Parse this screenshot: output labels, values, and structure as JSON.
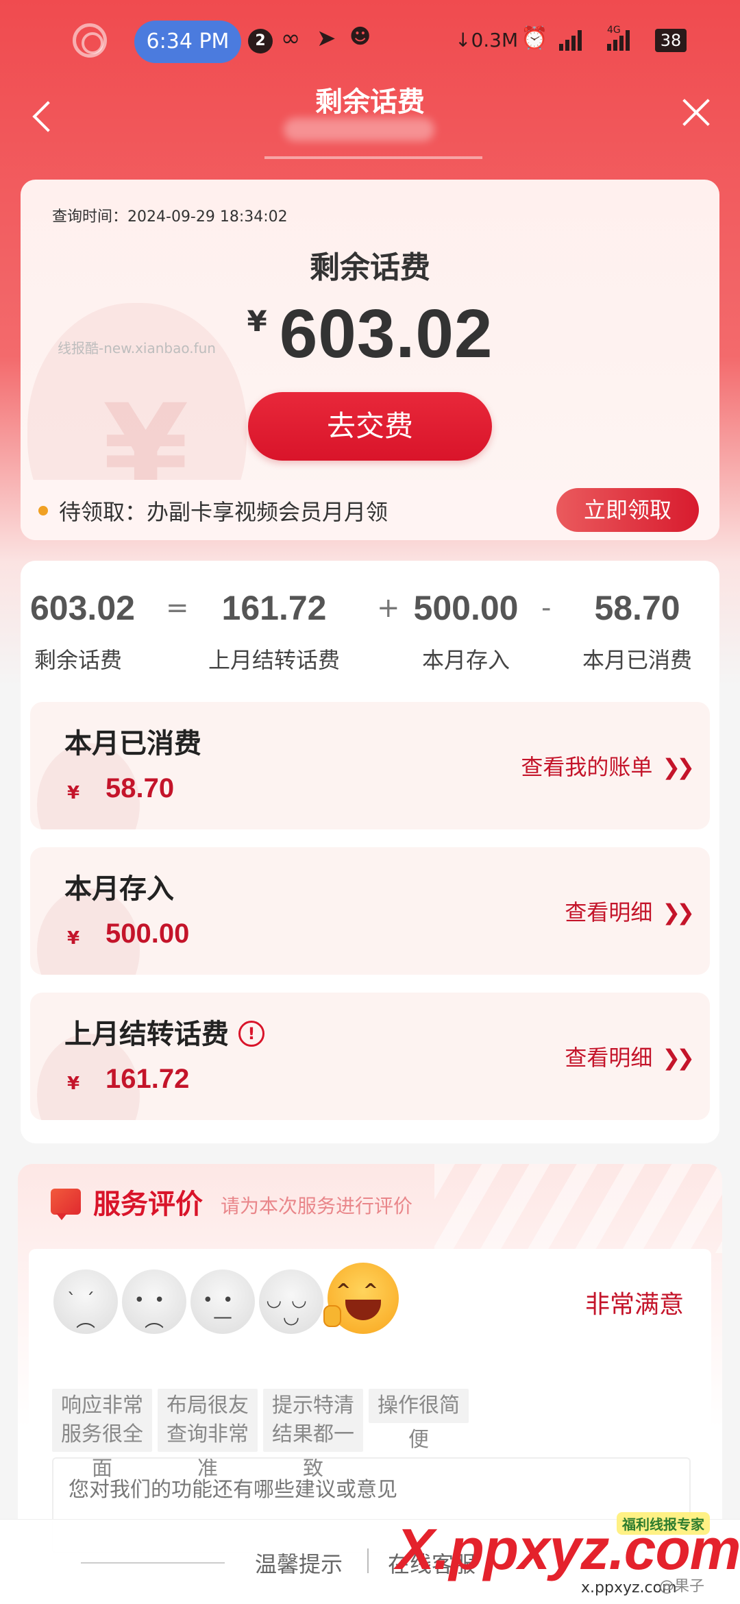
{
  "status_bar": {
    "time": "6:34 PM",
    "notification_count": "2",
    "net_speed": "0.3M",
    "network_type": "4G",
    "battery": "38"
  },
  "header": {
    "title": "剩余话费"
  },
  "balance": {
    "query_time_label": "查询时间：",
    "query_time": "2024-09-29 18:34:02",
    "title": "剩余话费",
    "currency": "¥",
    "amount": "603.02",
    "pay_button": "去交费",
    "watermark": "线报酷-new.xianbao.fun"
  },
  "promo": {
    "text": "待领取：办副卡享视频会员月月领",
    "button": "立即领取"
  },
  "equation": {
    "items": [
      {
        "value": "603.02",
        "label": "剩余话费"
      },
      {
        "value": "161.72",
        "label": "上月结转话费"
      },
      {
        "value": "500.00",
        "label": "本月存入"
      },
      {
        "value": "58.70",
        "label": "本月已消费"
      }
    ],
    "ops": [
      "=",
      "+",
      "-"
    ]
  },
  "details": [
    {
      "title": "本月已消费",
      "currency": "¥",
      "amount": "58.70",
      "link": "查看我的账单"
    },
    {
      "title": "本月存入",
      "currency": "¥",
      "amount": "500.00",
      "link": "查看明细"
    },
    {
      "title": "上月结转话费",
      "currency": "¥",
      "amount": "161.72",
      "link": "查看明细"
    }
  ],
  "rating": {
    "title": "服务评价",
    "hint": "请为本次服务进行评价",
    "selected_label": "非常满意",
    "tags": [
      "响应非常快",
      "布局很友好",
      "提示特清晰",
      "操作很简便",
      "服务很全面",
      "查询非常准",
      "结果都一致"
    ],
    "suggestion_placeholder": "您对我们的功能还有哪些建议或意见"
  },
  "bottom_bar": {
    "tips": "温馨提示",
    "online_service": "在线客服"
  },
  "overlay_watermark": {
    "brand": "X.ppxyz.com",
    "badge": "福利线报专家",
    "url": "x.ppxyz.com",
    "author": "@果子"
  },
  "colors": {
    "brand_red": "#d9142a",
    "header_red": "#f04b4f"
  }
}
